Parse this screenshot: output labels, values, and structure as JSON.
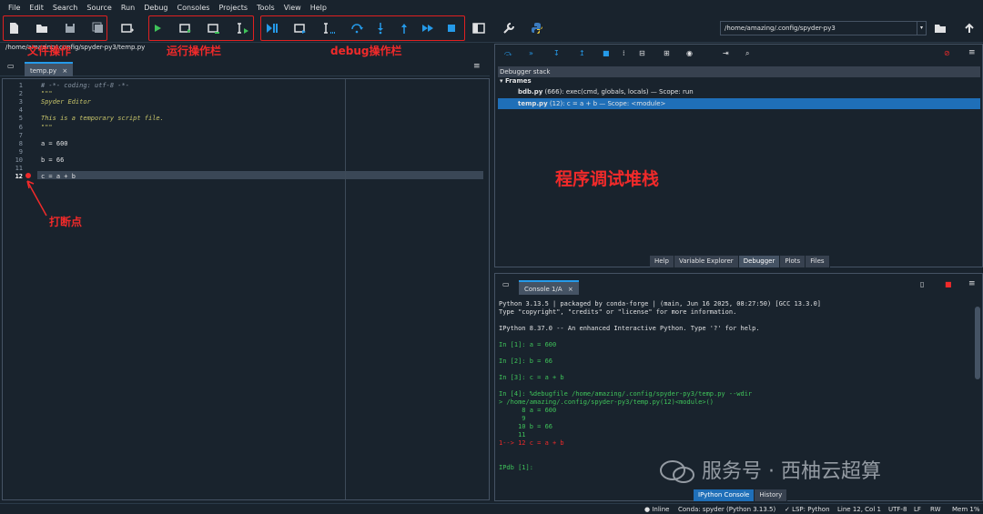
{
  "menu": [
    "File",
    "Edit",
    "Search",
    "Source",
    "Run",
    "Debug",
    "Consoles",
    "Projects",
    "Tools",
    "View",
    "Help"
  ],
  "annotations": {
    "file_ops": "文件操作",
    "run_bar": "运行操作栏",
    "debug_bar": "debug操作栏",
    "breakpoint": "打断点",
    "stack": "程序调试堆栈"
  },
  "toolbar": {
    "path": "/home/amazing/.config/spyder-py3"
  },
  "editor": {
    "path": "/home/amazing/.config/spyder-py3/temp.py",
    "tab": "temp.py",
    "lines": [
      {
        "n": "1",
        "t": "# -*- coding: utf-8 -*-"
      },
      {
        "n": "2",
        "t": "\"\"\""
      },
      {
        "n": "3",
        "t": "Spyder Editor"
      },
      {
        "n": "4",
        "t": ""
      },
      {
        "n": "5",
        "t": "This is a temporary script file."
      },
      {
        "n": "6",
        "t": "\"\"\""
      },
      {
        "n": "7",
        "t": ""
      },
      {
        "n": "8",
        "t": "a = 600"
      },
      {
        "n": "9",
        "t": ""
      },
      {
        "n": "10",
        "t": "b = 66"
      },
      {
        "n": "11",
        "t": ""
      },
      {
        "n": "12",
        "t": "c = a + b"
      }
    ]
  },
  "debugger": {
    "title": "Debugger stack",
    "frames_label": "Frames",
    "frames": [
      {
        "file": "bdb.py",
        "detail": "(666): exec(cmd, globals, locals)  —  Scope: run"
      },
      {
        "file": "temp.py",
        "detail": "(12): c = a + b  —  Scope: <module>"
      }
    ]
  },
  "pane_tabs": [
    "Help",
    "Variable Explorer",
    "Debugger",
    "Plots",
    "Files"
  ],
  "console": {
    "tab": "Console 1/A",
    "lines": [
      "Python 3.13.5 | packaged by conda-forge | (main, Jun 16 2025, 08:27:50) [GCC 13.3.0]",
      "Type \"copyright\", \"credits\" or \"license\" for more information.",
      "",
      "IPython 8.37.0 -- An enhanced Interactive Python. Type '?' for help.",
      "",
      "In [1]: a = 600",
      "",
      "In [2]: b = 66",
      "",
      "In [3]: c = a + b",
      "",
      "In [4]: %debugfile /home/amazing/.config/spyder-py3/temp.py --wdir",
      "> /home/amazing/.config/spyder-py3/temp.py(12)<module>()",
      "      8 a = 600",
      "      9",
      "     10 b = 66",
      "     11",
      "1--> 12 c = a + b",
      "",
      "",
      "IPdb [1]:"
    ],
    "tabs": [
      "IPython Console",
      "History"
    ]
  },
  "status": {
    "inline": "Inline",
    "conda": "Conda: spyder (Python 3.13.5)",
    "lsp": "LSP: Python",
    "pos": "Line 12, Col 1",
    "enc": "UTF-8",
    "eol": "LF",
    "rw": "RW",
    "mem": "Mem  1%"
  },
  "watermark": "服务号 · 西柚云超算",
  "colors": {
    "accent": "#259ae9",
    "annotation": "#f02a2a",
    "bg": "#19232d"
  }
}
